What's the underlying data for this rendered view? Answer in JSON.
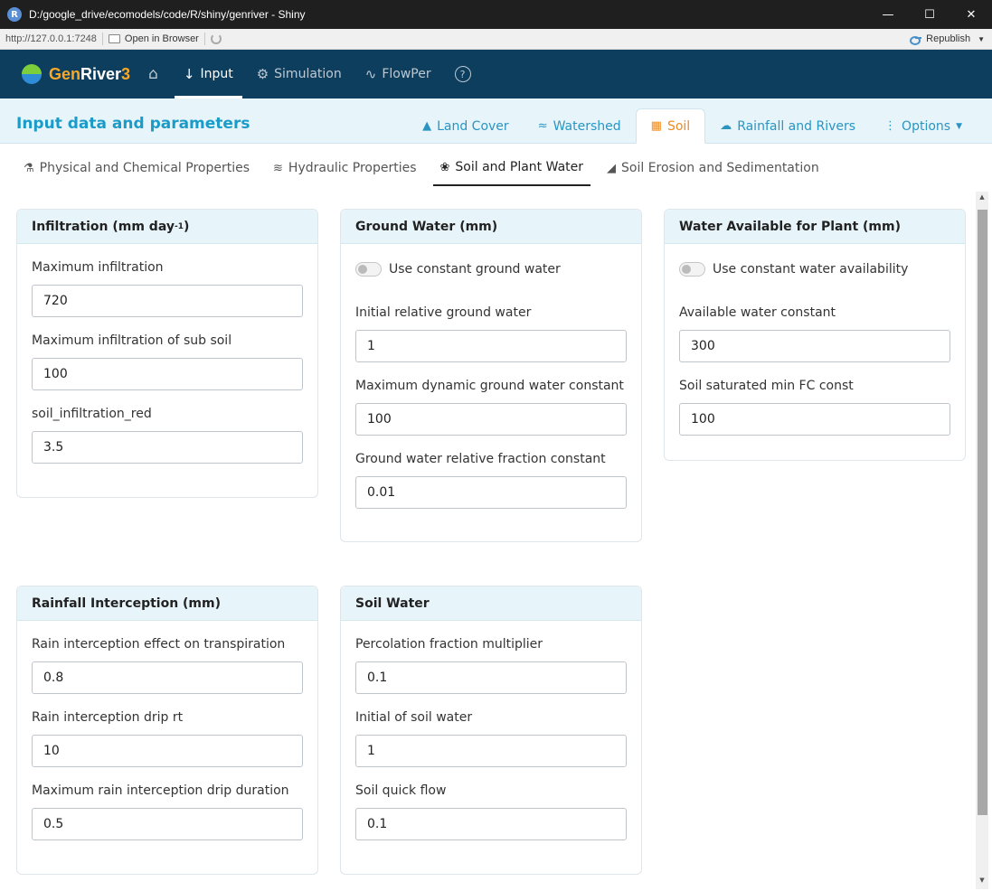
{
  "window": {
    "title": "D:/google_drive/ecomodels/code/R/shiny/genriver - Shiny",
    "app_icon_letter": "R"
  },
  "toolbar": {
    "url": "http://127.0.0.1:7248",
    "open_in_browser": "Open in Browser",
    "republish": "Republish"
  },
  "navbar": {
    "brand_part1": "Gen",
    "brand_part2": "River",
    "brand_part3": "3",
    "items": [
      {
        "label": "",
        "icon": "home-icon"
      },
      {
        "label": "Input",
        "icon": "arrow-down-icon",
        "active": true
      },
      {
        "label": "Simulation",
        "icon": "gears-icon"
      },
      {
        "label": "FlowPer",
        "icon": "pulse-icon"
      },
      {
        "label": "?",
        "icon": "help-icon"
      }
    ]
  },
  "section": {
    "title": "Input data and parameters",
    "tabs": [
      {
        "label": "Land Cover",
        "icon": "tree-icon"
      },
      {
        "label": "Watershed",
        "icon": "water-icon"
      },
      {
        "label": "Soil",
        "icon": "soil-icon",
        "active": true
      },
      {
        "label": "Rainfall and Rivers",
        "icon": "cloud-icon"
      },
      {
        "label": "Options",
        "icon": "dots-vertical-icon"
      }
    ]
  },
  "sub_tabs": [
    {
      "label": "Physical and Chemical Properties",
      "icon": "flask-icon"
    },
    {
      "label": "Hydraulic Properties",
      "icon": "water-ladder-icon"
    },
    {
      "label": "Soil and Plant Water",
      "icon": "seedling-icon",
      "active": true
    },
    {
      "label": "Soil Erosion and Sedimentation",
      "icon": "erosion-icon"
    }
  ],
  "cards": {
    "infiltration": {
      "title": "Infiltration (mm day",
      "title_sup": "-1",
      "title_close": ")",
      "fields": [
        {
          "label": "Maximum infiltration",
          "value": "720"
        },
        {
          "label": "Maximum infiltration of sub soil",
          "value": "100"
        },
        {
          "label": "soil_infiltration_red",
          "value": "3.5"
        }
      ]
    },
    "ground_water": {
      "title": "Ground Water (mm)",
      "toggle_label": "Use constant ground water",
      "fields": [
        {
          "label": "Initial relative ground water",
          "value": "1"
        },
        {
          "label": "Maximum dynamic ground water constant",
          "value": "100"
        },
        {
          "label": "Ground water relative fraction constant",
          "value": "0.01"
        }
      ]
    },
    "water_available": {
      "title": "Water Available for Plant (mm)",
      "toggle_label": "Use constant water availability",
      "fields": [
        {
          "label": "Available water constant",
          "value": "300"
        },
        {
          "label": "Soil saturated min FC const",
          "value": "100"
        }
      ]
    },
    "rainfall_interception": {
      "title": "Rainfall Interception (mm)",
      "fields": [
        {
          "label": "Rain interception effect on transpiration",
          "value": "0.8"
        },
        {
          "label": "Rain interception drip rt",
          "value": "10"
        },
        {
          "label": "Maximum rain interception drip duration",
          "value": "0.5"
        }
      ]
    },
    "soil_water": {
      "title": "Soil Water",
      "fields": [
        {
          "label": "Percolation fraction multiplier",
          "value": "0.1"
        },
        {
          "label": "Initial of soil water",
          "value": "1"
        },
        {
          "label": "Soil quick flow",
          "value": "0.1"
        }
      ]
    }
  },
  "colors": {
    "navbar_bg": "#0e3e5e",
    "section_band_bg": "#e7f5fb",
    "accent_blue": "#1b9bc8",
    "accent_orange": "#f08a1c",
    "brand_orange": "#f7a827"
  }
}
